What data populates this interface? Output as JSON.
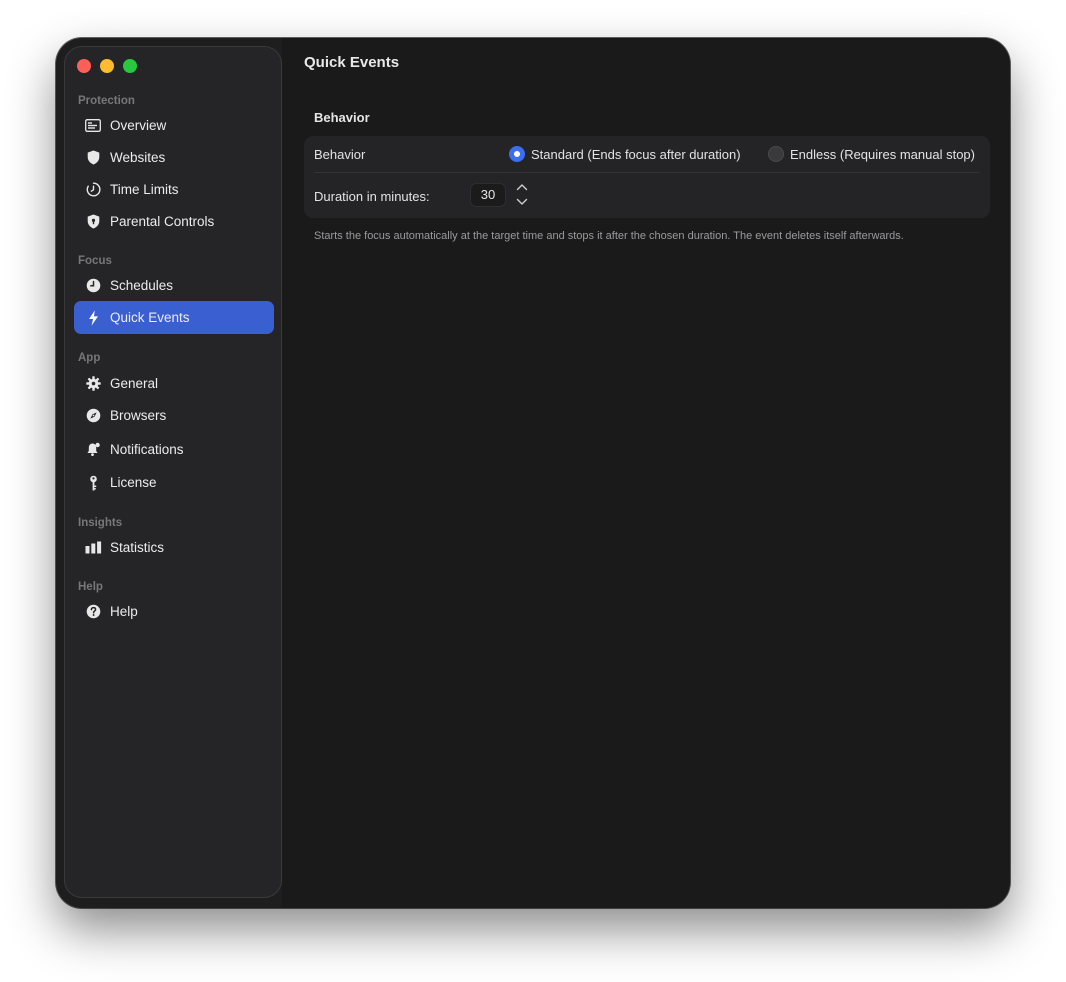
{
  "window": {
    "traffic_lights": {
      "close_color": "#ff5f57",
      "minimize_color": "#febc2e",
      "zoom_color": "#28c840"
    }
  },
  "sidebar": {
    "sections": [
      {
        "title": "Protection",
        "items": [
          {
            "label": "Overview",
            "icon": "overview-icon",
            "active": false
          },
          {
            "label": "Websites",
            "icon": "shield-icon",
            "active": false
          },
          {
            "label": "Time Limits",
            "icon": "timer-icon",
            "active": false
          },
          {
            "label": "Parental Controls",
            "icon": "shield-lock-icon",
            "active": false
          }
        ]
      },
      {
        "title": "Focus",
        "items": [
          {
            "label": "Schedules",
            "icon": "clock-icon",
            "active": false
          },
          {
            "label": "Quick Events",
            "icon": "bolt-icon",
            "active": true
          }
        ]
      },
      {
        "title": "App",
        "items": [
          {
            "label": "General",
            "icon": "gear-icon",
            "active": false
          },
          {
            "label": "Browsers",
            "icon": "compass-icon",
            "active": false
          },
          {
            "label": "Notifications",
            "icon": "bell-icon",
            "active": false
          },
          {
            "label": "License",
            "icon": "key-icon",
            "active": false
          }
        ]
      },
      {
        "title": "Insights",
        "items": [
          {
            "label": "Statistics",
            "icon": "bar-chart-icon",
            "active": false
          }
        ]
      },
      {
        "title": "Help",
        "items": [
          {
            "label": "Help",
            "icon": "question-icon",
            "active": false
          }
        ]
      }
    ],
    "accent_color": "#3a5fd0"
  },
  "main": {
    "title": "Quick Events",
    "group_title": "Behavior",
    "behavior": {
      "label": "Behavior",
      "options": [
        {
          "label": "Standard (Ends focus after duration)",
          "selected": true
        },
        {
          "label": "Endless (Requires manual stop)",
          "selected": false
        }
      ]
    },
    "duration": {
      "label": "Duration in minutes:",
      "value": "30"
    },
    "footnote": "Starts the focus automatically at the target time and stops it after the chosen duration. The event deletes itself afterwards."
  }
}
